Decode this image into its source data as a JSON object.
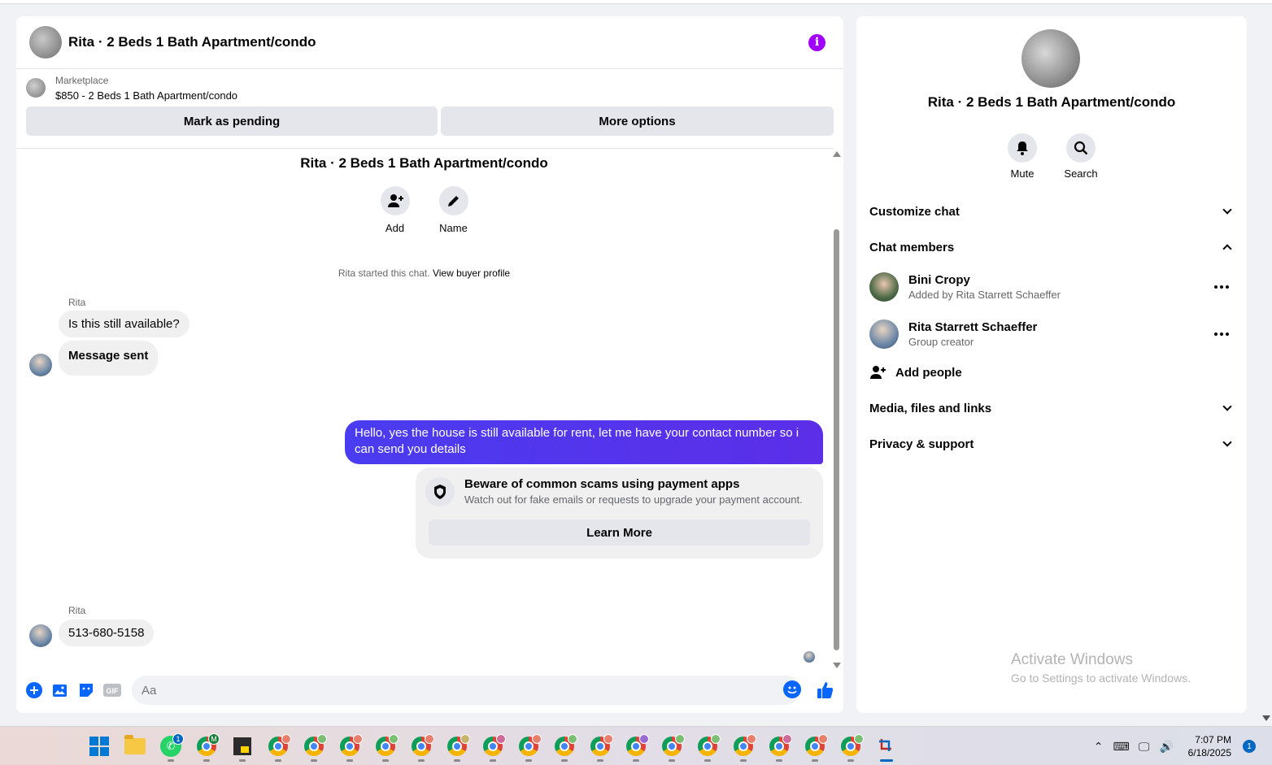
{
  "chat": {
    "header_title": "Rita · 2 Beds 1 Bath Apartment/condo",
    "marketplace_label": "Marketplace",
    "listing": "$850 - 2 Beds 1 Bath Apartment/condo",
    "mark_pending": "Mark as pending",
    "more_options": "More options",
    "convo_title": "Rita · 2 Beds 1 Bath Apartment/condo",
    "add_label": "Add",
    "name_label": "Name",
    "system_msg": "Rita started this chat.",
    "view_buyer_profile": "View buyer profile",
    "messages": {
      "sender_1": "Rita",
      "msg_1": "Is this still available?",
      "msg_2": "Message sent",
      "outgoing": "Hello, yes the house is still available for rent, let me have your contact number so i can send you  details",
      "sender_2": "Rita",
      "msg_3": "513-680-5158"
    },
    "warning": {
      "title": "Beware of common scams using payment apps",
      "body": "Watch out for fake emails or requests to upgrade your payment account.",
      "button": "Learn More"
    },
    "composer_placeholder": "Aa",
    "gif_label": "GIF"
  },
  "info_panel": {
    "title": "Rita · 2 Beds 1 Bath Apartment/condo",
    "mute": "Mute",
    "search": "Search",
    "customize_chat": "Customize chat",
    "chat_members": "Chat members",
    "members": [
      {
        "name": "Bini Cropy",
        "sub": "Added by Rita Starrett Schaeffer"
      },
      {
        "name": "Rita Starrett Schaeffer",
        "sub": "Group creator"
      }
    ],
    "add_people": "Add people",
    "media_files_links": "Media, files and links",
    "privacy_support": "Privacy & support"
  },
  "watermark": {
    "line1": "Activate Windows",
    "line2": "Go to Settings to activate Windows."
  },
  "taskbar": {
    "whatsapp_badge": "1",
    "gmail_badge": "M",
    "time": "7:07 PM",
    "date": "6/18/2025",
    "notifications": "1"
  },
  "colors": {
    "accent": "#0866ff",
    "outgoing_bubble": "#4a3cf0",
    "info_icon": "#a000ff"
  }
}
